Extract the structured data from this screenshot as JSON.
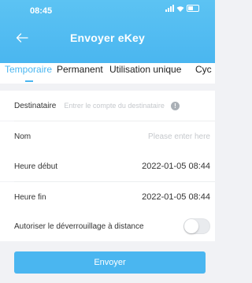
{
  "status_bar": {
    "time": "08:45"
  },
  "header": {
    "title": "Envoyer eKey",
    "back_icon": "arrow-left-icon"
  },
  "tabs": [
    {
      "label": "Temporaire",
      "active": true
    },
    {
      "label": "Permanent",
      "active": false
    },
    {
      "label": "Utilisation unique",
      "active": false
    },
    {
      "label": "Cyc",
      "active": false
    }
  ],
  "form": {
    "recipient": {
      "label": "Destinataire",
      "placeholder": "Entrer le compte du destinataire",
      "icon": "info-icon"
    },
    "name": {
      "label": "Nom",
      "placeholder": "Please enter here"
    },
    "start_time": {
      "label": "Heure début",
      "value": "2022-01-05 08:44"
    },
    "end_time": {
      "label": "Heure fin",
      "value": "2022-01-05 08:44"
    },
    "remote_unlock": {
      "label": "Autoriser le déverrouillage à distance",
      "enabled": false
    }
  },
  "send_button": {
    "label": "Envoyer"
  },
  "colors": {
    "accent": "#4ab6f0",
    "background": "#f1f2f5"
  }
}
